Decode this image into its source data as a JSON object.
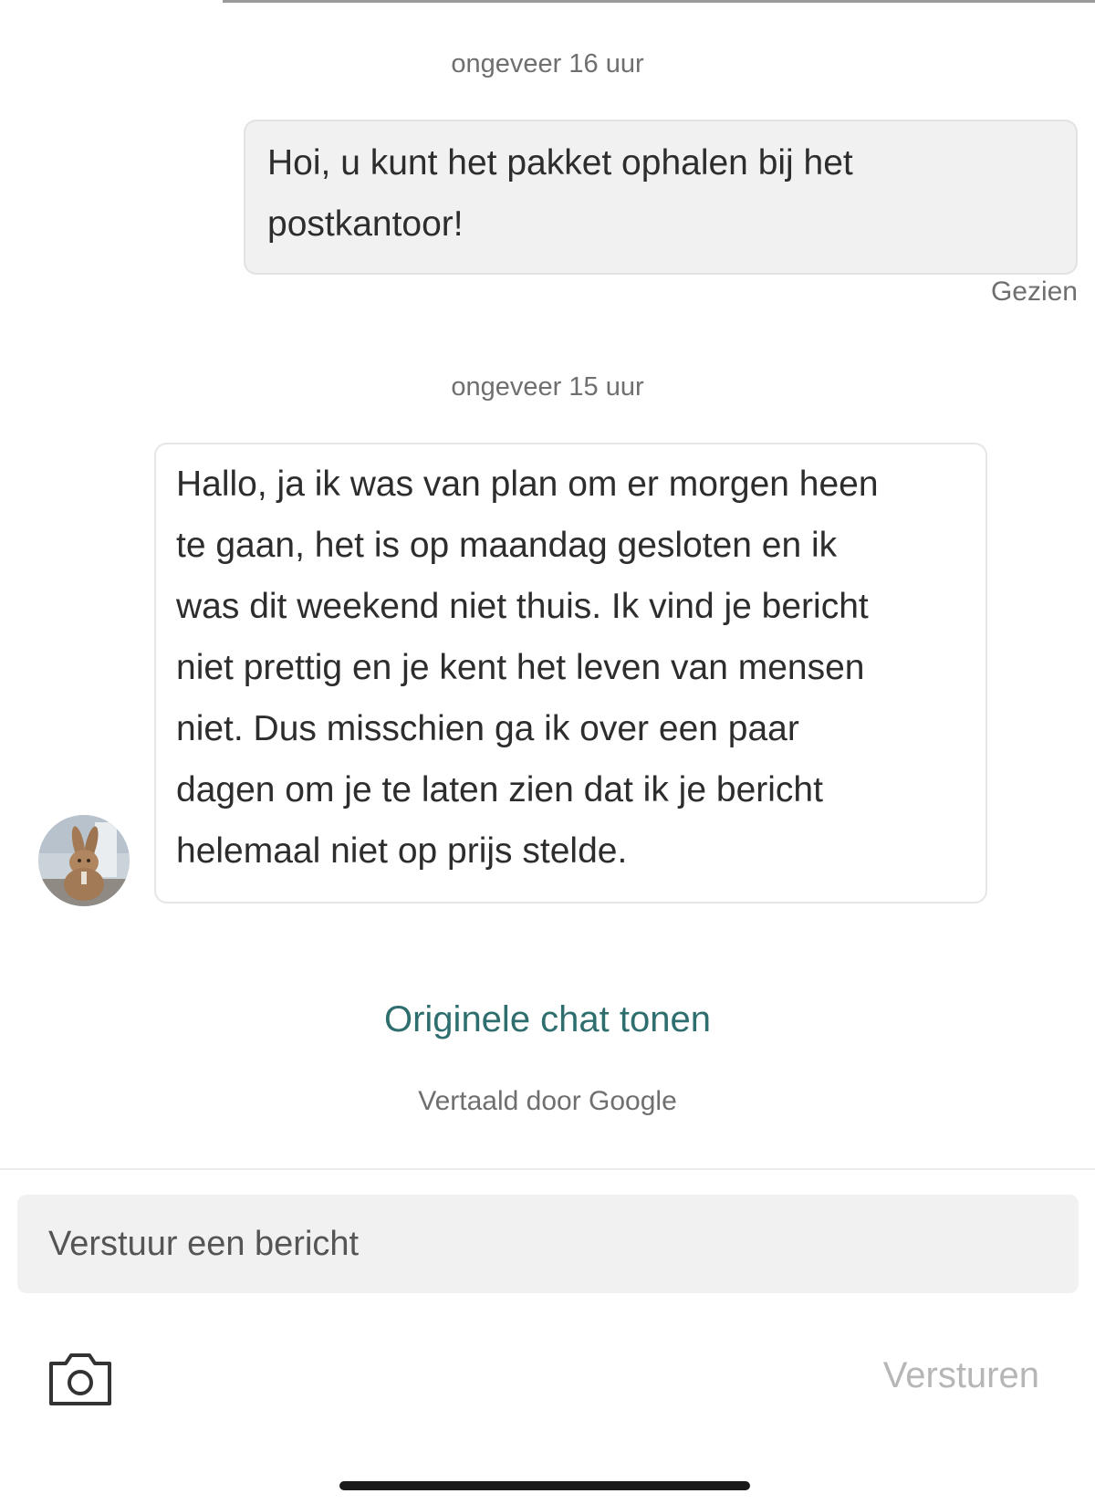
{
  "chat": {
    "messages": [
      {
        "timestamp": "ongeveer 16 uur",
        "direction": "outgoing",
        "lines": [
          "Hoi, u kunt het pakket ophalen bij het",
          "postkantoor!"
        ],
        "status": "Gezien"
      },
      {
        "timestamp": "ongeveer 15 uur",
        "direction": "incoming",
        "lines": [
          "Hallo, ja ik was van plan om er morgen heen",
          "te gaan, het is op maandag gesloten en ik",
          "was dit weekend niet thuis. Ik vind je bericht",
          "niet prettig en je kent het leven van mensen",
          "niet. Dus misschien ga ik over een paar",
          "dagen om je te laten zien dat ik je bericht",
          "helemaal niet op prijs stelde."
        ]
      }
    ],
    "show_original_label": "Originele chat tonen",
    "translated_by": "Vertaald door Google"
  },
  "composer": {
    "placeholder": "Verstuur een bericht",
    "send_label": "Versturen",
    "camera_icon": "camera-icon"
  },
  "colors": {
    "link": "#2f6e6e",
    "outgoing_bubble": "#f1f1f1",
    "send_disabled": "#b6b6b6"
  }
}
